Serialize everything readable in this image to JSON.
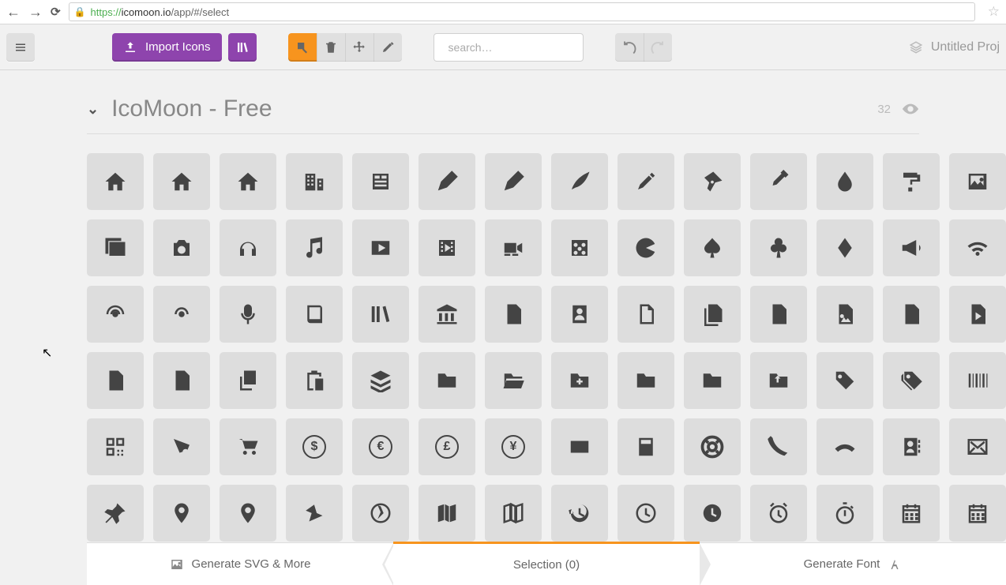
{
  "browser": {
    "url_scheme": "https://",
    "url_host": "icomoon.io",
    "url_path": "/app/#/select"
  },
  "toolbar": {
    "import_label": "Import Icons",
    "search_placeholder": "search…",
    "project_label": "Untitled Proj"
  },
  "set": {
    "title": "IcoMoon - Free",
    "visible_count": "32"
  },
  "icons": [
    "home",
    "home2",
    "home3",
    "office",
    "newspaper",
    "pencil",
    "pencil2",
    "quill",
    "pen",
    "nib",
    "eyedropper",
    "droplet",
    "paint-format",
    "image",
    "images",
    "camera",
    "headphones",
    "music",
    "play",
    "film",
    "video-camera",
    "dice",
    "pacman",
    "spades",
    "clubs",
    "diamonds",
    "bullhorn",
    "connection",
    "podcast",
    "feed",
    "mic",
    "book",
    "books",
    "library",
    "file-text",
    "profile",
    "file-empty",
    "files-empty",
    "file-text2",
    "file-picture",
    "file-music",
    "file-play",
    "file-video",
    "file-zip",
    "copy",
    "paste",
    "stack",
    "folder",
    "folder-open",
    "folder-plus",
    "folder-minus",
    "folder-download",
    "folder-upload",
    "price-tag",
    "price-tags",
    "barcode",
    "qrcode",
    "ticket",
    "cart",
    "coin-dollar",
    "coin-euro",
    "coin-pound",
    "coin-yen",
    "credit-card",
    "calculator",
    "lifebuoy",
    "phone",
    "phone-hang-up",
    "address-book",
    "envelop",
    "pushpin",
    "location",
    "location2",
    "compass",
    "compass2",
    "map",
    "map2",
    "history",
    "clock",
    "clock2",
    "alarm",
    "stopwatch",
    "calendar",
    "calendar2"
  ],
  "bottom": {
    "left_label": "Generate SVG & More",
    "center_prefix": "Selection (",
    "center_count": "0",
    "center_suffix": ")",
    "right_label": "Generate Font"
  }
}
